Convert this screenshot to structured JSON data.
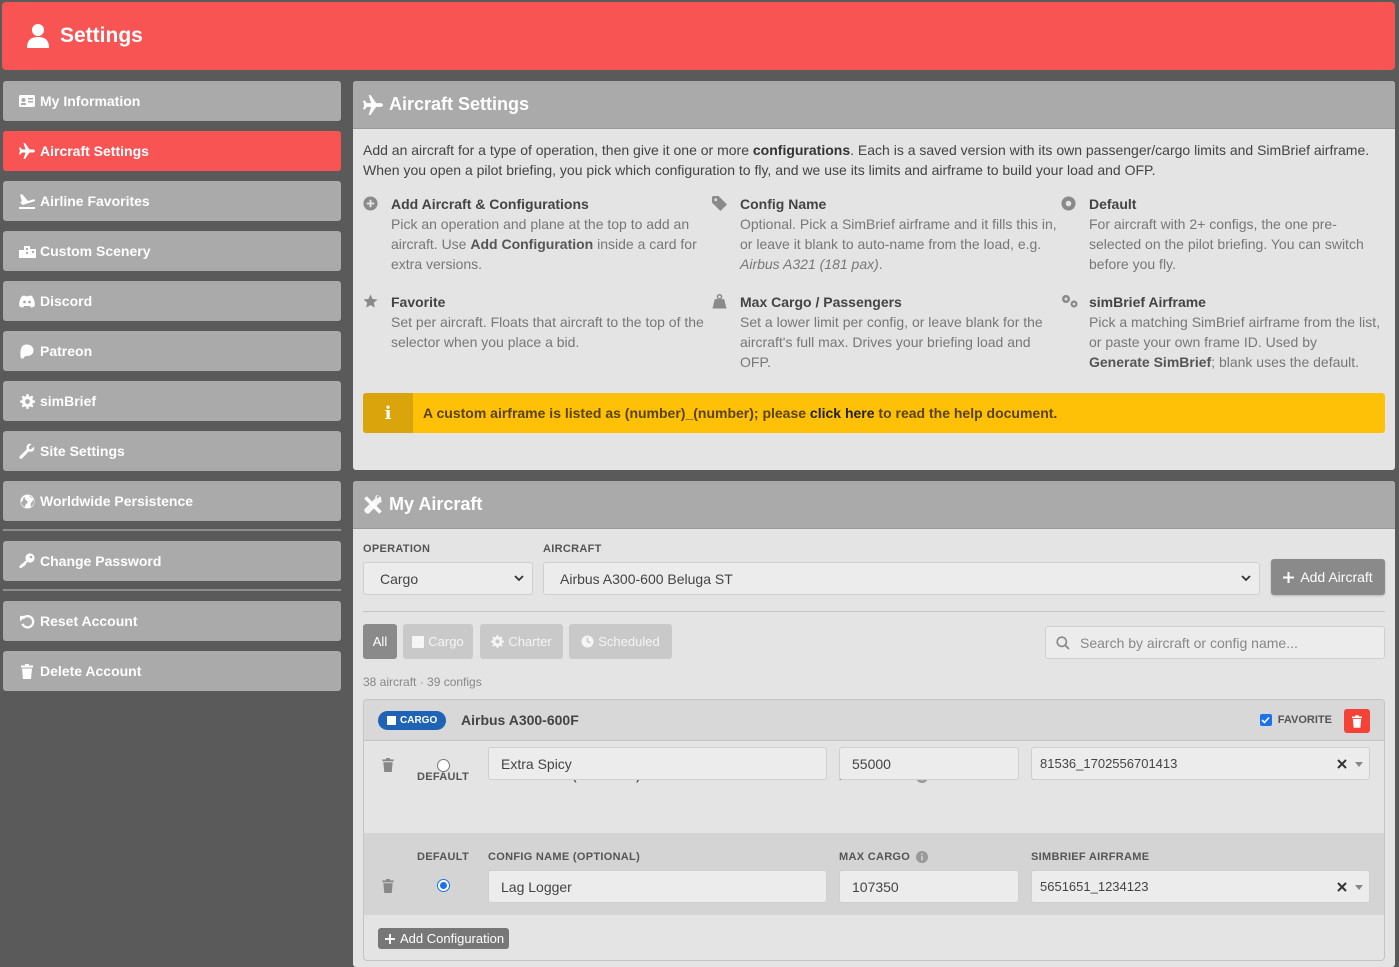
{
  "header": {
    "title": "Settings"
  },
  "sidebar": {
    "items": [
      {
        "label": "My Information",
        "icon": "id-card-icon"
      },
      {
        "label": "Aircraft Settings",
        "icon": "plane-icon",
        "active": true
      },
      {
        "label": "Airline Favorites",
        "icon": "plane-departure-icon"
      },
      {
        "label": "Custom Scenery",
        "icon": "city-icon"
      },
      {
        "label": "Discord",
        "icon": "discord-icon"
      },
      {
        "label": "Patreon",
        "icon": "patreon-icon"
      },
      {
        "label": "simBrief",
        "icon": "cog-icon"
      },
      {
        "label": "Site Settings",
        "icon": "wrench-icon"
      },
      {
        "label": "Worldwide Persistence",
        "icon": "globe-icon"
      }
    ],
    "account": [
      {
        "label": "Change Password",
        "icon": "key-icon"
      }
    ],
    "danger": [
      {
        "label": "Reset Account",
        "icon": "undo-icon"
      },
      {
        "label": "Delete Account",
        "icon": "trash-icon"
      }
    ]
  },
  "aircraft_settings": {
    "title": "Aircraft Settings",
    "intro": {
      "p1": "Add an aircraft for a type of operation, then give it one or more ",
      "p1_bold": "configurations",
      "p2": ". Each is a saved version with its own passenger/cargo limits and SimBrief airframe. When you open a pilot briefing, you pick which configuration to fly, and we use its limits and airframe to build your load and OFP."
    },
    "help": [
      {
        "title": "Add Aircraft & Configurations",
        "icon": "plus-circle-icon",
        "d1": "Pick an operation and plane at the top to add an aircraft. Use ",
        "b": "Add Configuration",
        "d2": " inside a card for extra versions."
      },
      {
        "title": "Config Name",
        "icon": "tag-icon",
        "d1": "Optional. Pick a SimBrief airframe and it fills this in, or leave it blank to auto-name from the load, e.g. ",
        "i": "Airbus A321 (181 pax)",
        "d2": "."
      },
      {
        "title": "Default",
        "icon": "dot-circle-icon",
        "d1": "For aircraft with 2+ configs, the one pre-selected on the pilot briefing. You can switch before you fly."
      },
      {
        "title": "Favorite",
        "icon": "star-icon",
        "d1": "Set per aircraft. Floats that aircraft to the top of the selector when you place a bid."
      },
      {
        "title": "Max Cargo / Passengers",
        "icon": "weight-icon",
        "d1": "Set a lower limit per config, or leave blank for the aircraft's full max. Drives your briefing load and OFP."
      },
      {
        "title": "simBrief Airframe",
        "icon": "cogs-icon",
        "d1": "Pick a matching SimBrief airframe from the list, or paste your own frame ID. Used by ",
        "b": "Generate SimBrief",
        "d2": "; blank uses the default."
      }
    ],
    "alert": {
      "icon_text": "i",
      "t1": "A custom airframe is listed as (number)_(number); please ",
      "link": "click here",
      "t2": " to read the help document."
    }
  },
  "my_aircraft": {
    "title": "My Aircraft",
    "operation_label": "OPERATION",
    "operation_value": "Cargo",
    "aircraft_label": "AIRCRAFT",
    "aircraft_value": "Airbus A300-600 Beluga ST",
    "add_aircraft": "Add Aircraft",
    "filters": [
      {
        "label": "All",
        "active": true
      },
      {
        "label": "Cargo"
      },
      {
        "label": "Charter"
      },
      {
        "label": "Scheduled"
      }
    ],
    "search_placeholder": "Search by aircraft or config name...",
    "counts": "38 aircraft · 39 configs",
    "card": {
      "badge": "CARGO",
      "name": "Airbus A300-600F",
      "favorite_label": "FAVORITE",
      "favorite": true,
      "default_label": "DEFAULT",
      "config_name_label": "CONFIG NAME (OPTIONAL)",
      "max_cargo_label": "MAX CARGO",
      "airframe_label": "SIMBRIEF AIRFRAME",
      "configs": [
        {
          "name": "Extra Spicy",
          "max_cargo": "55000",
          "airframe": "81536_1702556701413",
          "default": false
        },
        {
          "name": "Lag Logger",
          "max_cargo": "107350",
          "airframe": "5651651_1234123",
          "default": true
        }
      ],
      "add_configuration": "Add Configuration"
    }
  },
  "colors": {
    "accent": "#f95454",
    "sidebar_item": "#aaaaaa",
    "badge": "#1e63b5",
    "alert": "#ffc107"
  }
}
